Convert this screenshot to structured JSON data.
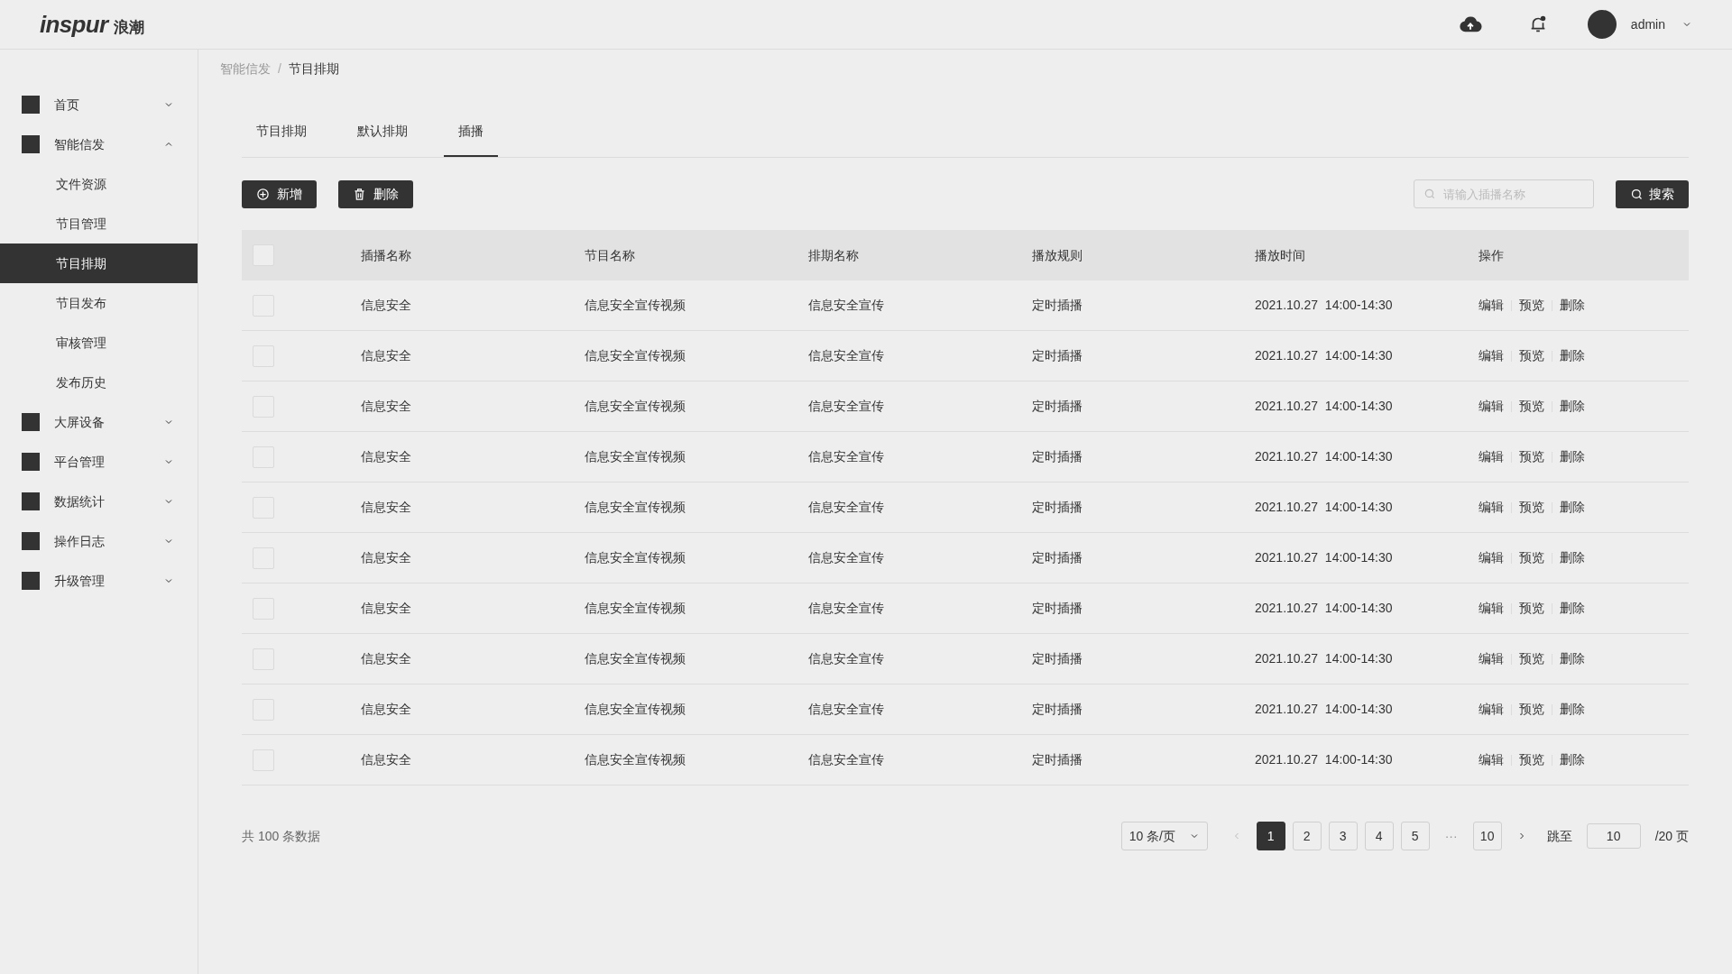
{
  "header": {
    "logo_latin": "inspur",
    "logo_cjk": "浪潮",
    "user": "admin"
  },
  "sidebar": {
    "items": [
      {
        "label": "首页",
        "expanded": false
      },
      {
        "label": "智能信发",
        "expanded": true,
        "children": [
          {
            "label": "文件资源",
            "selected": false
          },
          {
            "label": "节目管理",
            "selected": false
          },
          {
            "label": "节目排期",
            "selected": true
          },
          {
            "label": "节目发布",
            "selected": false
          },
          {
            "label": "审核管理",
            "selected": false
          },
          {
            "label": "发布历史",
            "selected": false
          }
        ]
      },
      {
        "label": "大屏设备",
        "expanded": false
      },
      {
        "label": "平台管理",
        "expanded": false
      },
      {
        "label": "数据统计",
        "expanded": false
      },
      {
        "label": "操作日志",
        "expanded": false
      },
      {
        "label": "升级管理",
        "expanded": false
      }
    ]
  },
  "breadcrumb": {
    "separator": "/",
    "items": [
      "智能信发",
      "节目排期"
    ]
  },
  "tabs": [
    {
      "label": "节目排期",
      "selected": false
    },
    {
      "label": "默认排期",
      "selected": false
    },
    {
      "label": "插播",
      "selected": true
    }
  ],
  "toolbar": {
    "add": "新增",
    "delete": "删除",
    "search_placeholder": "请输入插播名称",
    "search": "搜索"
  },
  "table": {
    "header_checked": false,
    "columns": [
      "插播名称",
      "节目名称",
      "排期名称",
      "播放规则",
      "播放时间",
      "操作"
    ],
    "rows": [
      {
        "checked": false,
        "cells": [
          "信息安全",
          "信息安全宣传视频",
          "信息安全宣传",
          "定时插播",
          "2021.10.27  14:00-14:30"
        ],
        "actions": [
          "编辑",
          "预览",
          "删除"
        ]
      },
      {
        "checked": false,
        "cells": [
          "信息安全",
          "信息安全宣传视频",
          "信息安全宣传",
          "定时插播",
          "2021.10.27  14:00-14:30"
        ],
        "actions": [
          "编辑",
          "预览",
          "删除"
        ]
      },
      {
        "checked": false,
        "cells": [
          "信息安全",
          "信息安全宣传视频",
          "信息安全宣传",
          "定时插播",
          "2021.10.27  14:00-14:30"
        ],
        "actions": [
          "编辑",
          "预览",
          "删除"
        ]
      },
      {
        "checked": false,
        "cells": [
          "信息安全",
          "信息安全宣传视频",
          "信息安全宣传",
          "定时插播",
          "2021.10.27  14:00-14:30"
        ],
        "actions": [
          "编辑",
          "预览",
          "删除"
        ]
      },
      {
        "checked": false,
        "cells": [
          "信息安全",
          "信息安全宣传视频",
          "信息安全宣传",
          "定时插播",
          "2021.10.27  14:00-14:30"
        ],
        "actions": [
          "编辑",
          "预览",
          "删除"
        ]
      },
      {
        "checked": false,
        "cells": [
          "信息安全",
          "信息安全宣传视频",
          "信息安全宣传",
          "定时插播",
          "2021.10.27  14:00-14:30"
        ],
        "actions": [
          "编辑",
          "预览",
          "删除"
        ]
      },
      {
        "checked": false,
        "cells": [
          "信息安全",
          "信息安全宣传视频",
          "信息安全宣传",
          "定时插播",
          "2021.10.27  14:00-14:30"
        ],
        "actions": [
          "编辑",
          "预览",
          "删除"
        ]
      },
      {
        "checked": false,
        "cells": [
          "信息安全",
          "信息安全宣传视频",
          "信息安全宣传",
          "定时插播",
          "2021.10.27  14:00-14:30"
        ],
        "actions": [
          "编辑",
          "预览",
          "删除"
        ]
      },
      {
        "checked": false,
        "cells": [
          "信息安全",
          "信息安全宣传视频",
          "信息安全宣传",
          "定时插播",
          "2021.10.27  14:00-14:30"
        ],
        "actions": [
          "编辑",
          "预览",
          "删除"
        ]
      },
      {
        "checked": false,
        "cells": [
          "信息安全",
          "信息安全宣传视频",
          "信息安全宣传",
          "定时插播",
          "2021.10.27  14:00-14:30"
        ],
        "actions": [
          "编辑",
          "预览",
          "删除"
        ]
      }
    ]
  },
  "pagination": {
    "total": "共 100 条数据",
    "page_size": "10 条/页",
    "pages": [
      {
        "kind": "page",
        "label": "1",
        "selected": true
      },
      {
        "kind": "page",
        "label": "2",
        "selected": false
      },
      {
        "kind": "page",
        "label": "3",
        "selected": false
      },
      {
        "kind": "page",
        "label": "4",
        "selected": false
      },
      {
        "kind": "page",
        "label": "5",
        "selected": false
      },
      {
        "kind": "ellipsis",
        "label": "···"
      },
      {
        "kind": "page",
        "label": "10",
        "selected": false
      }
    ],
    "jump_label": "跳至",
    "jump_value": "10",
    "page_count": "/20 页"
  }
}
